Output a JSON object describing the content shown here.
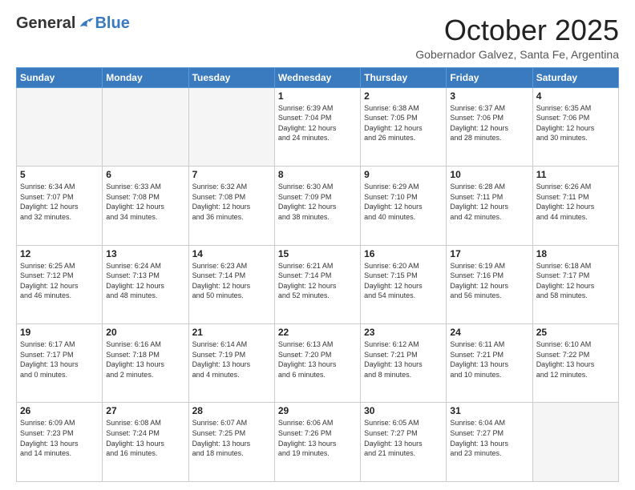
{
  "header": {
    "logo_general": "General",
    "logo_blue": "Blue",
    "month_title": "October 2025",
    "location": "Gobernador Galvez, Santa Fe, Argentina"
  },
  "days_of_week": [
    "Sunday",
    "Monday",
    "Tuesday",
    "Wednesday",
    "Thursday",
    "Friday",
    "Saturday"
  ],
  "weeks": [
    [
      {
        "day": "",
        "info": ""
      },
      {
        "day": "",
        "info": ""
      },
      {
        "day": "",
        "info": ""
      },
      {
        "day": "1",
        "info": "Sunrise: 6:39 AM\nSunset: 7:04 PM\nDaylight: 12 hours\nand 24 minutes."
      },
      {
        "day": "2",
        "info": "Sunrise: 6:38 AM\nSunset: 7:05 PM\nDaylight: 12 hours\nand 26 minutes."
      },
      {
        "day": "3",
        "info": "Sunrise: 6:37 AM\nSunset: 7:06 PM\nDaylight: 12 hours\nand 28 minutes."
      },
      {
        "day": "4",
        "info": "Sunrise: 6:35 AM\nSunset: 7:06 PM\nDaylight: 12 hours\nand 30 minutes."
      }
    ],
    [
      {
        "day": "5",
        "info": "Sunrise: 6:34 AM\nSunset: 7:07 PM\nDaylight: 12 hours\nand 32 minutes."
      },
      {
        "day": "6",
        "info": "Sunrise: 6:33 AM\nSunset: 7:08 PM\nDaylight: 12 hours\nand 34 minutes."
      },
      {
        "day": "7",
        "info": "Sunrise: 6:32 AM\nSunset: 7:08 PM\nDaylight: 12 hours\nand 36 minutes."
      },
      {
        "day": "8",
        "info": "Sunrise: 6:30 AM\nSunset: 7:09 PM\nDaylight: 12 hours\nand 38 minutes."
      },
      {
        "day": "9",
        "info": "Sunrise: 6:29 AM\nSunset: 7:10 PM\nDaylight: 12 hours\nand 40 minutes."
      },
      {
        "day": "10",
        "info": "Sunrise: 6:28 AM\nSunset: 7:11 PM\nDaylight: 12 hours\nand 42 minutes."
      },
      {
        "day": "11",
        "info": "Sunrise: 6:26 AM\nSunset: 7:11 PM\nDaylight: 12 hours\nand 44 minutes."
      }
    ],
    [
      {
        "day": "12",
        "info": "Sunrise: 6:25 AM\nSunset: 7:12 PM\nDaylight: 12 hours\nand 46 minutes."
      },
      {
        "day": "13",
        "info": "Sunrise: 6:24 AM\nSunset: 7:13 PM\nDaylight: 12 hours\nand 48 minutes."
      },
      {
        "day": "14",
        "info": "Sunrise: 6:23 AM\nSunset: 7:14 PM\nDaylight: 12 hours\nand 50 minutes."
      },
      {
        "day": "15",
        "info": "Sunrise: 6:21 AM\nSunset: 7:14 PM\nDaylight: 12 hours\nand 52 minutes."
      },
      {
        "day": "16",
        "info": "Sunrise: 6:20 AM\nSunset: 7:15 PM\nDaylight: 12 hours\nand 54 minutes."
      },
      {
        "day": "17",
        "info": "Sunrise: 6:19 AM\nSunset: 7:16 PM\nDaylight: 12 hours\nand 56 minutes."
      },
      {
        "day": "18",
        "info": "Sunrise: 6:18 AM\nSunset: 7:17 PM\nDaylight: 12 hours\nand 58 minutes."
      }
    ],
    [
      {
        "day": "19",
        "info": "Sunrise: 6:17 AM\nSunset: 7:17 PM\nDaylight: 13 hours\nand 0 minutes."
      },
      {
        "day": "20",
        "info": "Sunrise: 6:16 AM\nSunset: 7:18 PM\nDaylight: 13 hours\nand 2 minutes."
      },
      {
        "day": "21",
        "info": "Sunrise: 6:14 AM\nSunset: 7:19 PM\nDaylight: 13 hours\nand 4 minutes."
      },
      {
        "day": "22",
        "info": "Sunrise: 6:13 AM\nSunset: 7:20 PM\nDaylight: 13 hours\nand 6 minutes."
      },
      {
        "day": "23",
        "info": "Sunrise: 6:12 AM\nSunset: 7:21 PM\nDaylight: 13 hours\nand 8 minutes."
      },
      {
        "day": "24",
        "info": "Sunrise: 6:11 AM\nSunset: 7:21 PM\nDaylight: 13 hours\nand 10 minutes."
      },
      {
        "day": "25",
        "info": "Sunrise: 6:10 AM\nSunset: 7:22 PM\nDaylight: 13 hours\nand 12 minutes."
      }
    ],
    [
      {
        "day": "26",
        "info": "Sunrise: 6:09 AM\nSunset: 7:23 PM\nDaylight: 13 hours\nand 14 minutes."
      },
      {
        "day": "27",
        "info": "Sunrise: 6:08 AM\nSunset: 7:24 PM\nDaylight: 13 hours\nand 16 minutes."
      },
      {
        "day": "28",
        "info": "Sunrise: 6:07 AM\nSunset: 7:25 PM\nDaylight: 13 hours\nand 18 minutes."
      },
      {
        "day": "29",
        "info": "Sunrise: 6:06 AM\nSunset: 7:26 PM\nDaylight: 13 hours\nand 19 minutes."
      },
      {
        "day": "30",
        "info": "Sunrise: 6:05 AM\nSunset: 7:27 PM\nDaylight: 13 hours\nand 21 minutes."
      },
      {
        "day": "31",
        "info": "Sunrise: 6:04 AM\nSunset: 7:27 PM\nDaylight: 13 hours\nand 23 minutes."
      },
      {
        "day": "",
        "info": ""
      }
    ]
  ]
}
